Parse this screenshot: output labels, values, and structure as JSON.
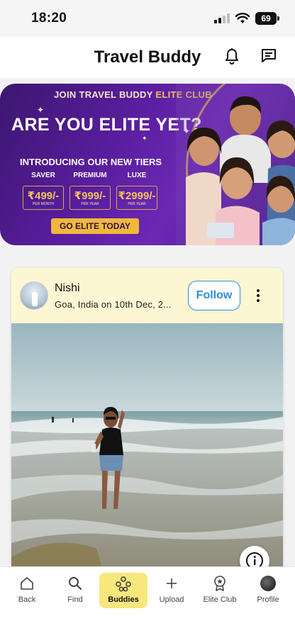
{
  "status_bar": {
    "time": "18:20",
    "battery": "69"
  },
  "header": {
    "title": "Travel Buddy",
    "notifications_icon": "bell-icon",
    "messages_icon": "chat-icon"
  },
  "banner": {
    "join_prefix": "JOIN TRAVEL BUDDY ",
    "join_highlight": "ELITE CLUB",
    "headline": "ARE YOU ELITE YET?",
    "intro": "INTRODUCING OUR NEW TIERS",
    "tiers": [
      {
        "name": "SAVER",
        "price": "₹499/-",
        "period": "PER MONTH"
      },
      {
        "name": "PREMIUM",
        "price": "₹999/-",
        "period": "PER YEAR"
      },
      {
        "name": "LUXE",
        "price": "₹2999/-",
        "period": "PER YEAR"
      }
    ],
    "cta": "GO ELITE TODAY",
    "colors": {
      "purple": "#5a1ea0",
      "gold": "#f0b93a"
    }
  },
  "post": {
    "author": "Nishi",
    "location": "Goa, India on 10th Dec, 2...",
    "follow_label": "Follow",
    "more_icon": "more-vertical-icon",
    "info_icon": "info-icon",
    "colors": {
      "header_bg": "#fdf6d3",
      "follow": "#2c8ed4"
    }
  },
  "bottom_nav": {
    "items": [
      {
        "label": "Back",
        "icon": "home-icon"
      },
      {
        "label": "Find",
        "icon": "search-icon"
      },
      {
        "label": "Buddies",
        "icon": "buddies-icon"
      },
      {
        "label": "Upload",
        "icon": "plus-icon"
      },
      {
        "label": "Elite Club",
        "icon": "badge-icon"
      },
      {
        "label": "Profile",
        "icon": "profile-avatar"
      }
    ],
    "active": "Buddies",
    "active_color": "#f7e77d"
  }
}
